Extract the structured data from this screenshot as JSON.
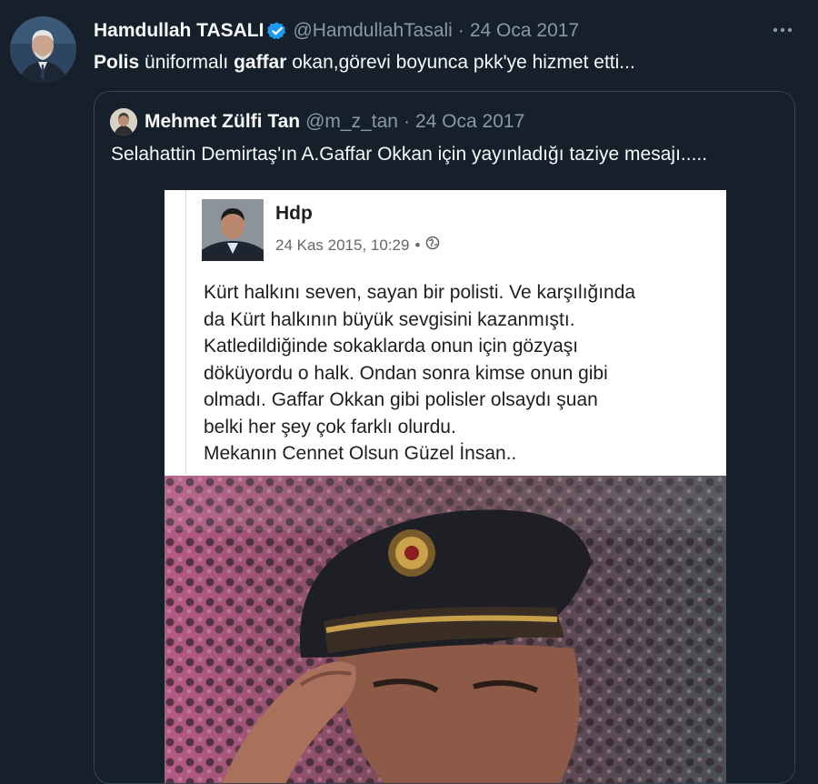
{
  "tweet": {
    "display_name": "Hamdullah TASALI",
    "handle": "@HamdullahTasali",
    "separator": "·",
    "date": "24 Oca 2017",
    "text_bold_1": "Polis",
    "text_part_1": " üniformalı ",
    "text_bold_2": "gaffar",
    "text_part_2": " okan,görevi boyunca pkk'ye hizmet etti...",
    "icons": {
      "verified": "verified-badge-icon",
      "more": "more-options-icon"
    },
    "colors": {
      "background": "#15202b",
      "secondary_text": "#8b98a5",
      "verified": "#1d9bf0",
      "border": "#38444d"
    }
  },
  "quote": {
    "display_name": "Mehmet Zülfi Tan",
    "handle": "@m_z_tan",
    "separator": "·",
    "date": "24 Oca 2017",
    "text": "Selahattin Demirtaş'ın A.Gaffar Okkan için yayınladığı taziye mesajı.....",
    "media": {
      "post": {
        "page_name": "Hdp",
        "timestamp": "24 Kas 2015, 10:29",
        "meta_separator": "•",
        "privacy_icon": "globe-icon",
        "body_lines": [
          "Kürt halkını seven, sayan bir polisti. Ve karşılığında",
          "da Kürt halkının büyük sevgisini kazanmıştı.",
          "Katledildiğinde sokaklarda onun için gözyaşı",
          "döküyordu o halk. Ondan sonra kimse onun gibi",
          "olmadı. Gaffar Okkan gibi polisler olsaydı şuan",
          "belki her şey çok farklı olurdu.",
          "Mekanın Cennet Olsun Güzel İnsan.."
        ]
      }
    }
  }
}
